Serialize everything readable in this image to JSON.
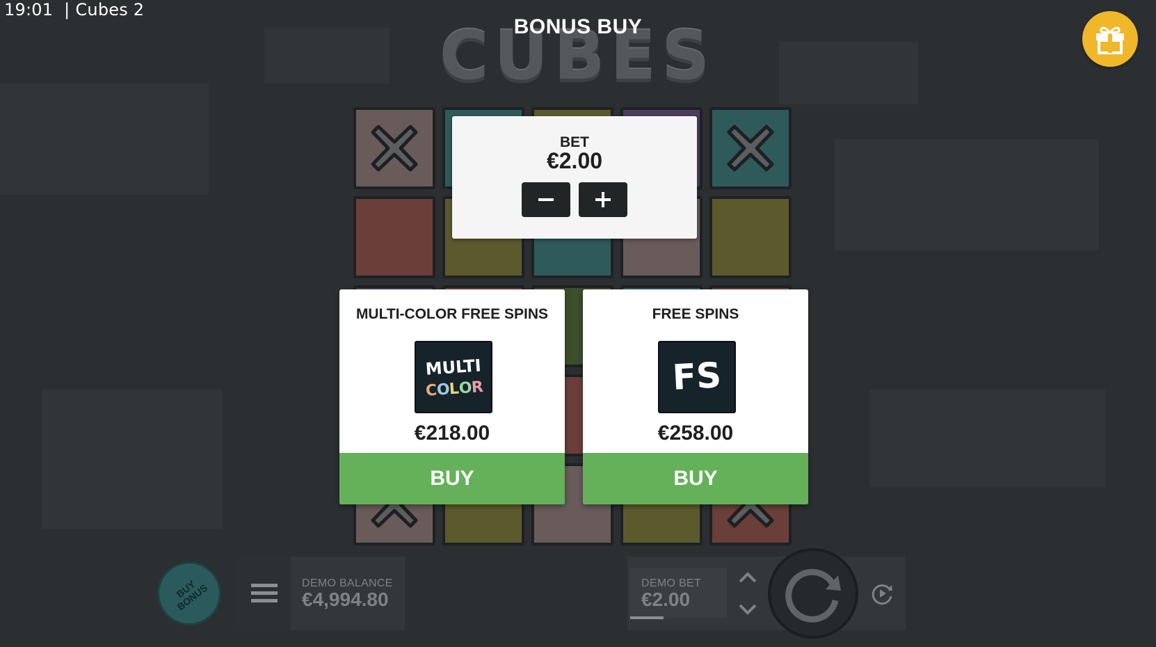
{
  "status_bar": {
    "time": "19:01",
    "separator": "|",
    "game_name": "Cubes 2"
  },
  "header": {
    "title": "BONUS BUY",
    "logo_text": "CUBES",
    "gift_icon": "gift-icon"
  },
  "bet_panel": {
    "label": "BET",
    "value": "€2.00",
    "decrease_icon": "minus-icon",
    "increase_icon": "plus-icon"
  },
  "offers": [
    {
      "title": "MULTI-COLOR FREE SPINS",
      "icon_name": "multi-color-icon",
      "icon_text_top": "MULTI",
      "icon_text_bottom": "COLOR",
      "price": "€218.00",
      "buy_label": "BUY"
    },
    {
      "title": "FREE SPINS",
      "icon_name": "free-spins-icon",
      "icon_text": "FS",
      "price": "€258.00",
      "buy_label": "BUY"
    }
  ],
  "bottom_bar": {
    "buy_bonus_label_1": "BUY",
    "buy_bonus_label_2": "BONUS",
    "balance_label": "DEMO BALANCE",
    "balance_value": "€4,994.80",
    "bet_label": "DEMO BET",
    "bet_value": "€2.00"
  },
  "colors": {
    "accent_gold": "#f1b72a",
    "buy_green": "#65b15a",
    "background": "#2b2f31"
  }
}
